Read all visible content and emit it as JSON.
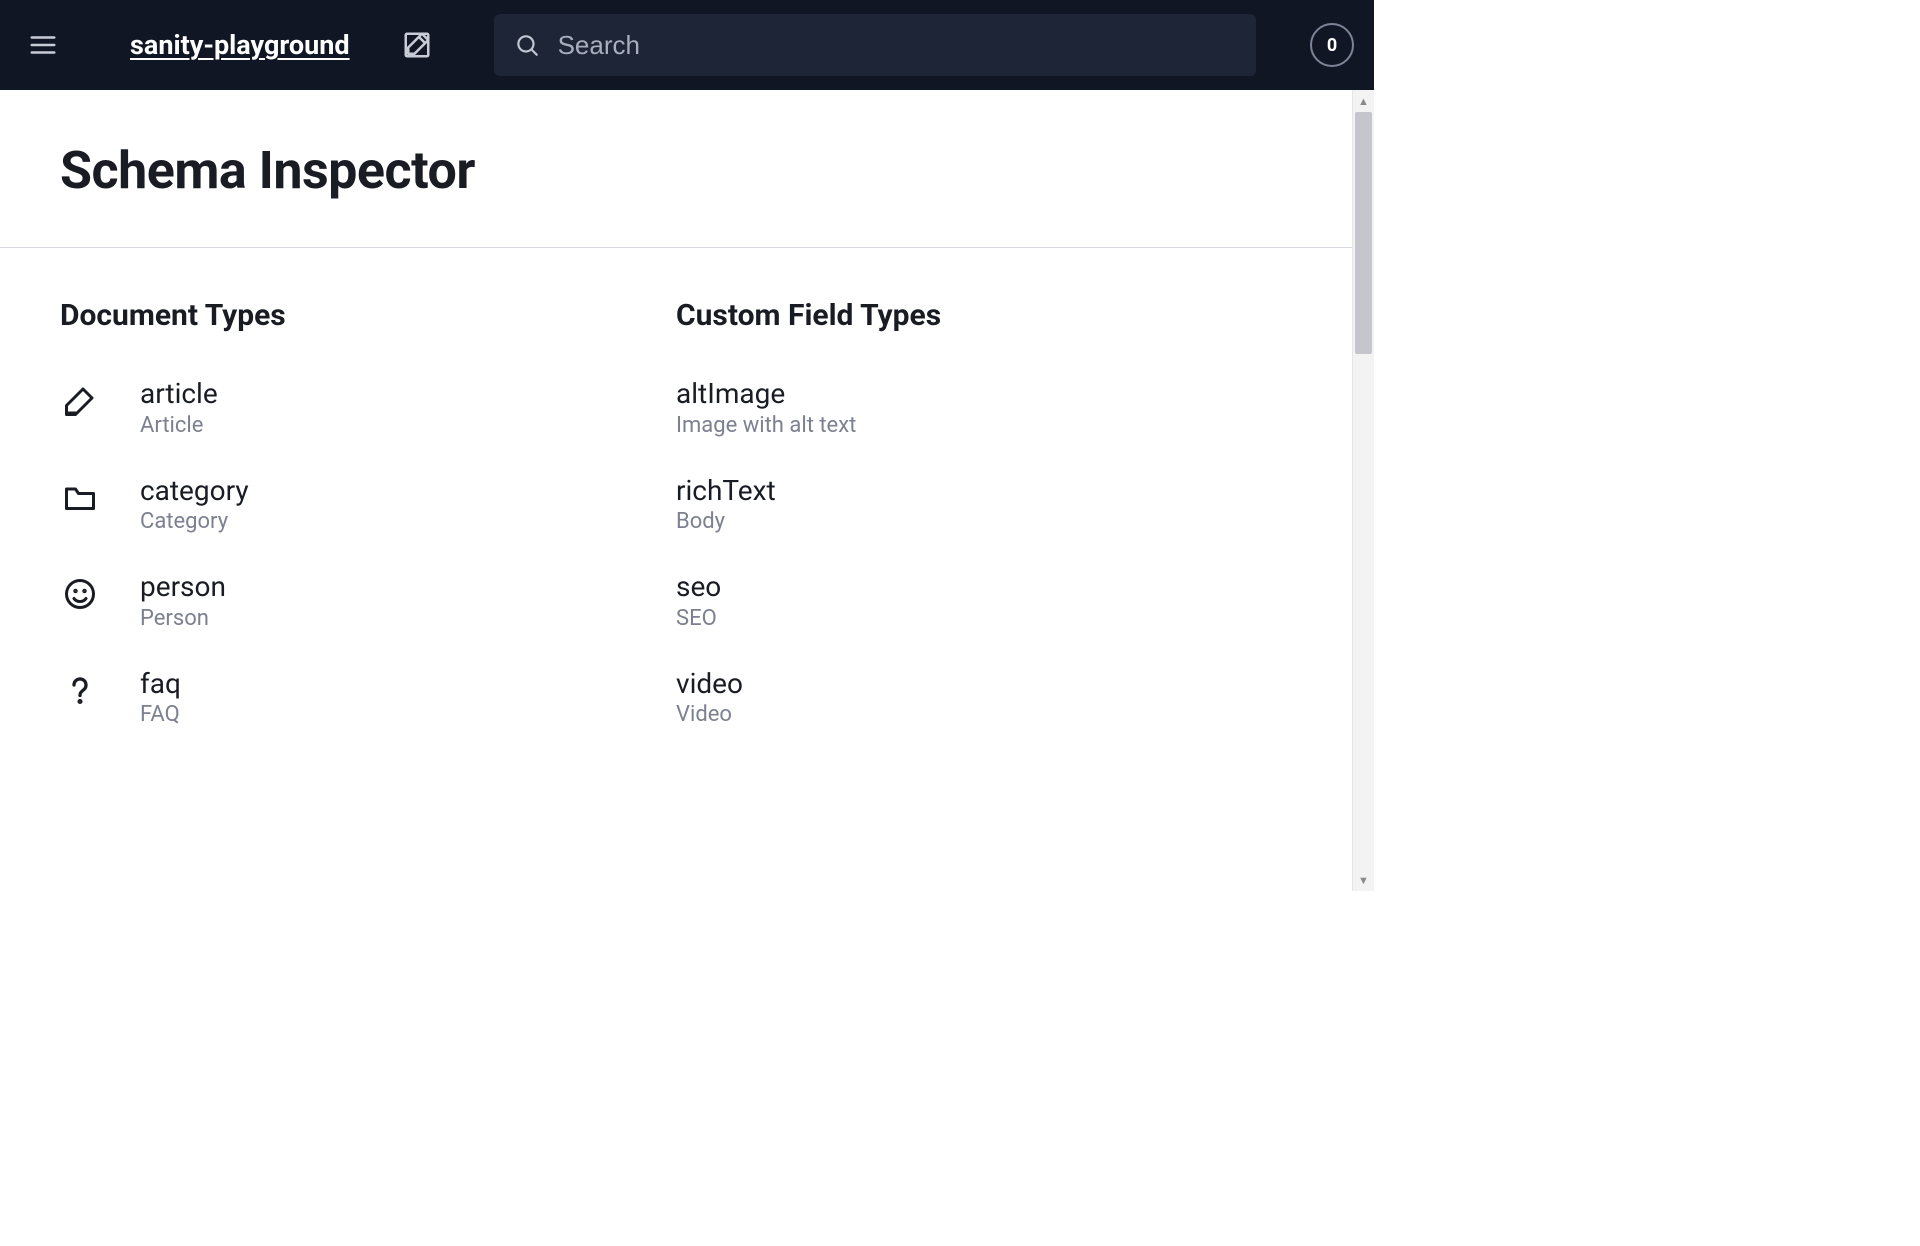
{
  "header": {
    "workspace": "sanity-playground",
    "search_placeholder": "Search",
    "badge_count": "0"
  },
  "page": {
    "title": "Schema Inspector",
    "doc_heading": "Document Types",
    "field_heading": "Custom Field Types"
  },
  "document_types": [
    {
      "name": "article",
      "title": "Article",
      "icon": "compose"
    },
    {
      "name": "category",
      "title": "Category",
      "icon": "folder"
    },
    {
      "name": "person",
      "title": "Person",
      "icon": "smile"
    },
    {
      "name": "faq",
      "title": "FAQ",
      "icon": "question"
    }
  ],
  "field_types": [
    {
      "name": "altImage",
      "title": "Image with alt text"
    },
    {
      "name": "richText",
      "title": "Body"
    },
    {
      "name": "seo",
      "title": "SEO"
    },
    {
      "name": "video",
      "title": "Video"
    }
  ]
}
